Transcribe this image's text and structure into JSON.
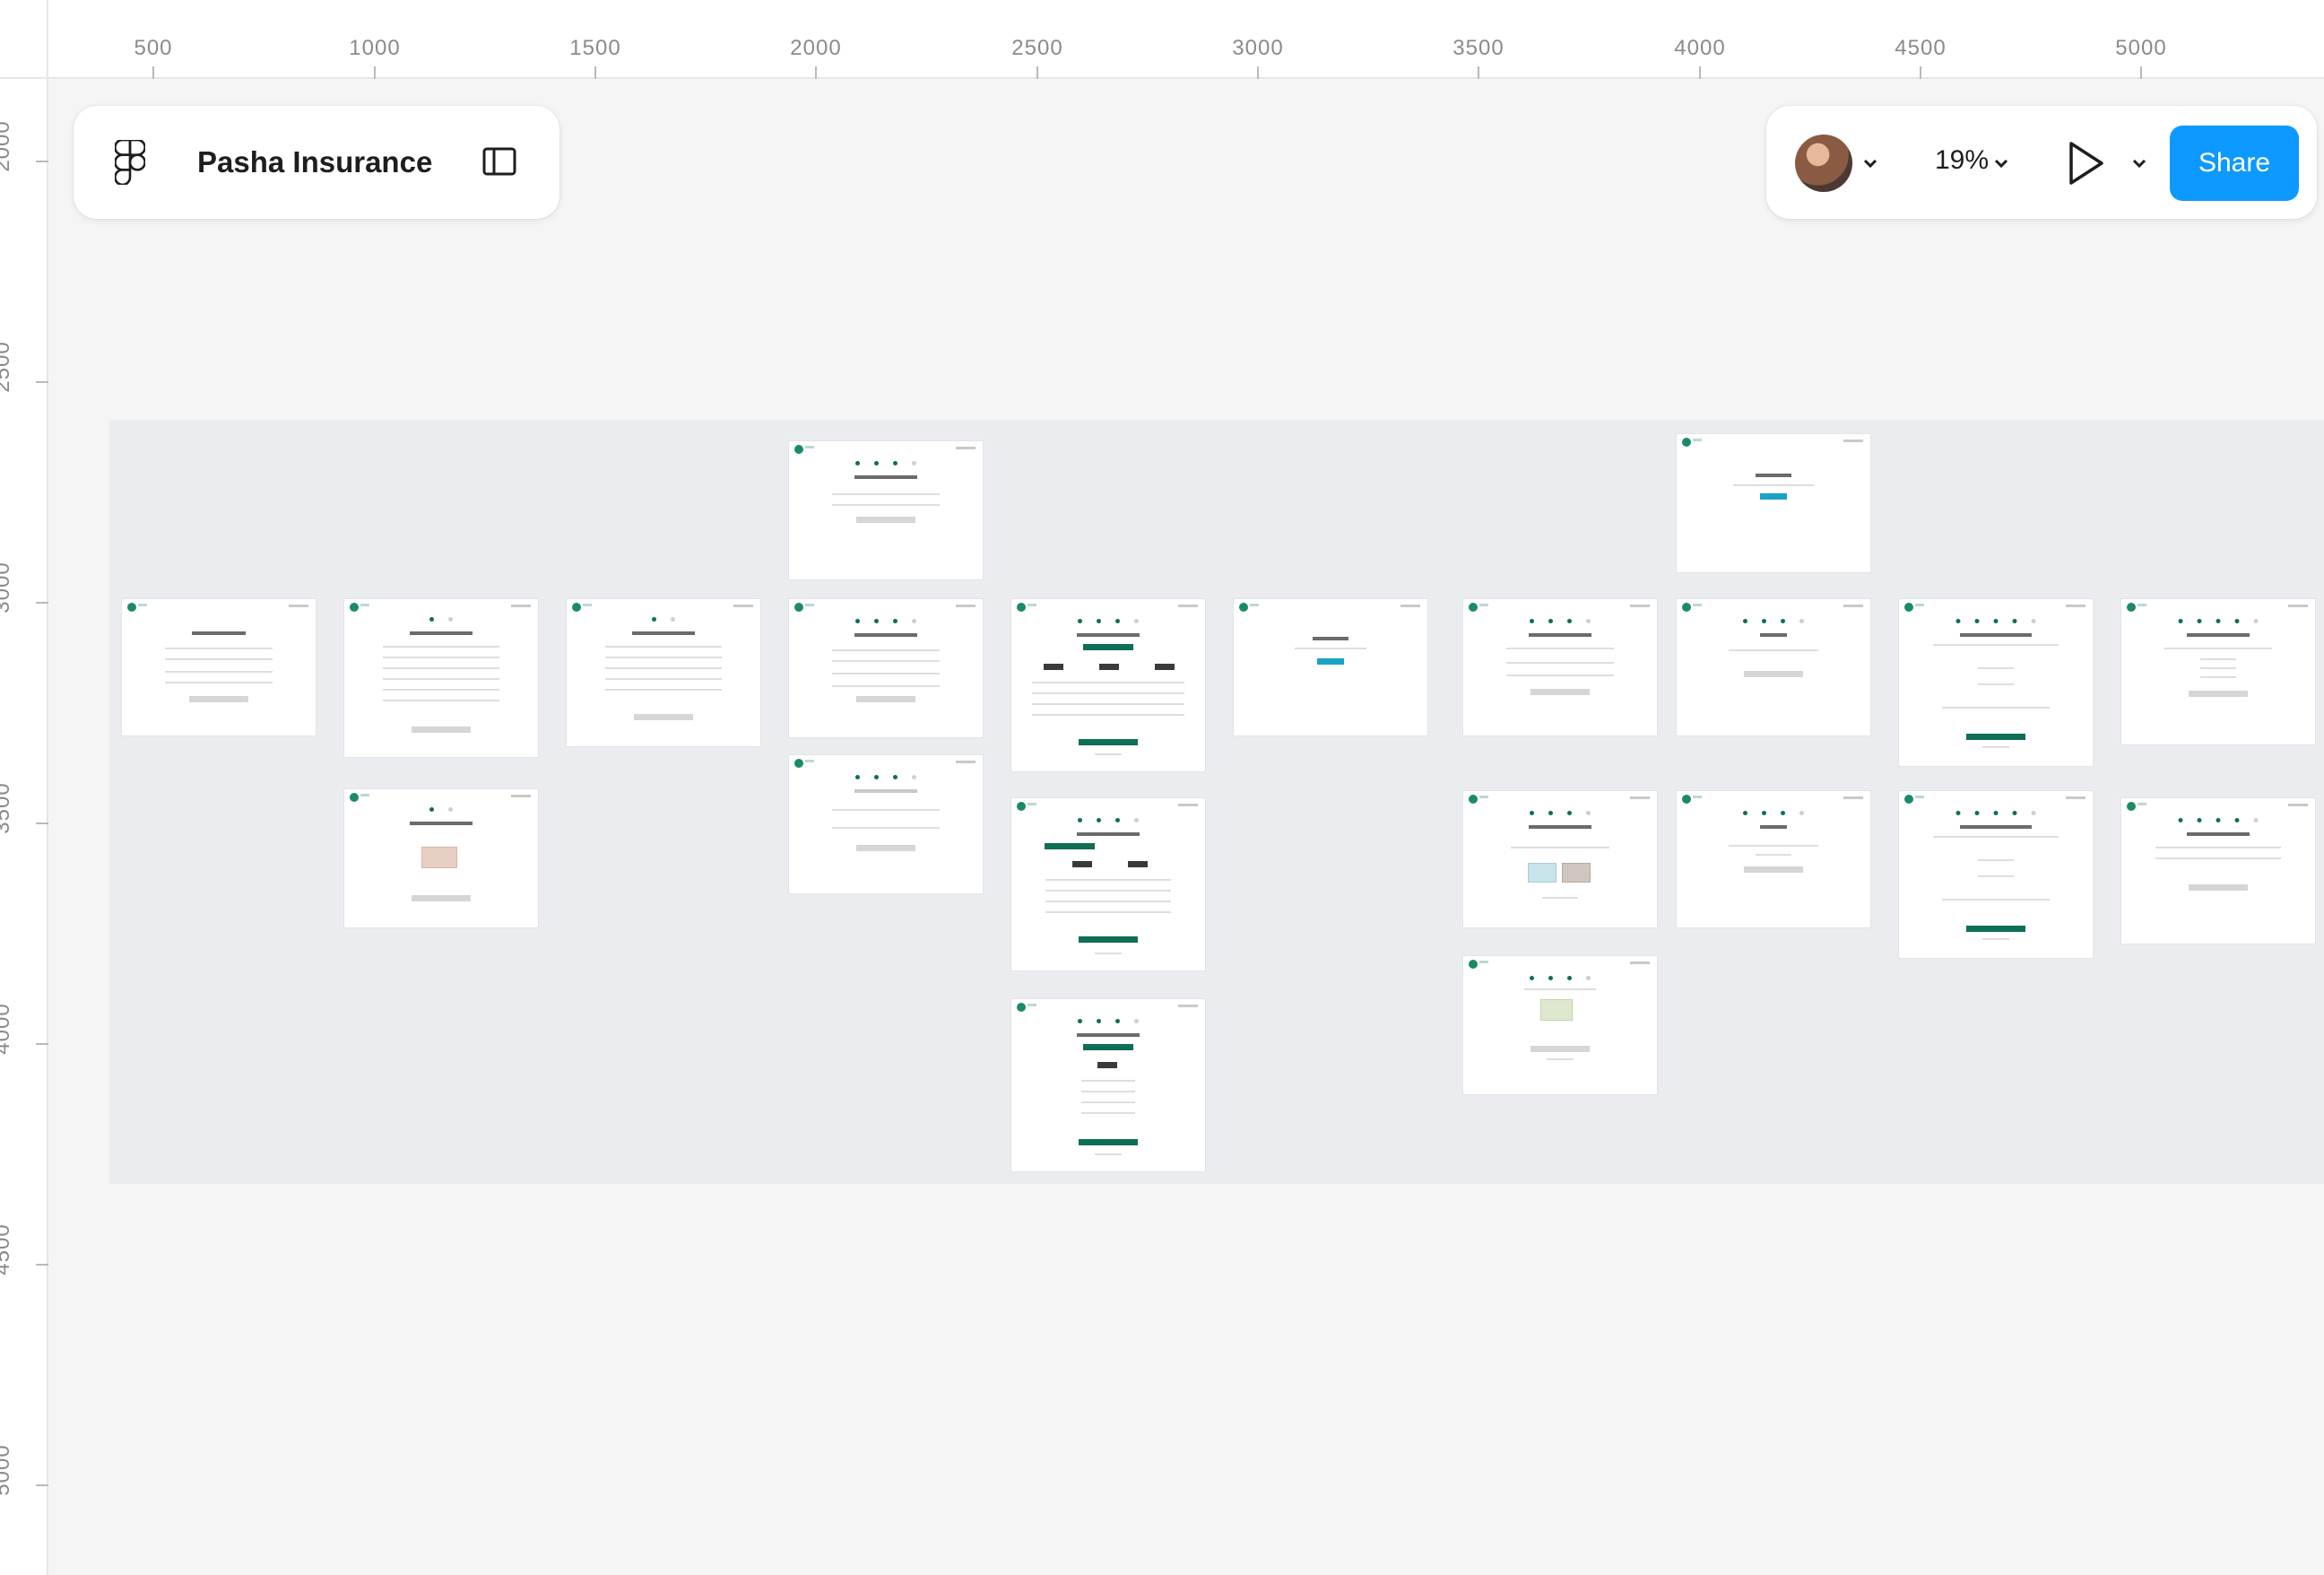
{
  "file": {
    "title": "Pasha Insurance"
  },
  "toolbar": {
    "zoom": "19%",
    "share_label": "Share"
  },
  "rulers": {
    "x_ticks": [
      "500",
      "1000",
      "1500",
      "2000",
      "2500",
      "3000",
      "3500",
      "4000",
      "4500",
      "5000"
    ],
    "y_ticks": [
      "2000",
      "2500",
      "3000",
      "3500",
      "4000",
      "4500",
      "5000"
    ]
  },
  "icons": {
    "app": "figma-logo-icon",
    "sidebar": "sidebar-toggle-icon",
    "user": "avatar",
    "menu": "chevron-down-icon",
    "present": "play-icon"
  },
  "colors": {
    "share": "#0d99ff",
    "brand_green": "#0f6e56",
    "section": "#ebecef",
    "canvas": "#f5f5f5"
  }
}
